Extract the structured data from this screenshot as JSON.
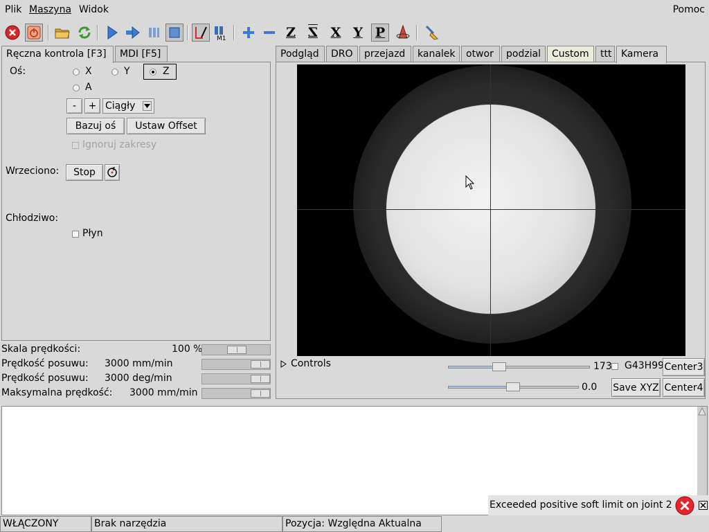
{
  "menu": {
    "file": "Plik",
    "machine": "Maszyna",
    "view": "Widok",
    "help": "Pomoc"
  },
  "toolbar": {
    "icons": [
      "estop-icon",
      "power-icon",
      "open-file-icon",
      "reload-icon",
      "run-icon",
      "step-icon",
      "pause-icon",
      "stop-icon",
      "block-delete-icon",
      "optional-stop-icon",
      "zoom-in-icon",
      "zoom-out-icon",
      "view-z-icon",
      "view-z-rotated-icon",
      "view-x-icon",
      "view-y-icon",
      "view-p-icon",
      "rotate-view-icon",
      "clear-backplot-icon"
    ],
    "m1_label": "M1",
    "view_letters": {
      "z": "Z",
      "z2": "Z",
      "x": "X",
      "y": "Y",
      "p": "P"
    }
  },
  "left_tabs": [
    "Ręczna kontrola [F3]",
    "MDI [F5]"
  ],
  "manual": {
    "axis_label": "Oś:",
    "axes": {
      "x": "X",
      "y": "Y",
      "z": "Z",
      "a": "A"
    },
    "selected_axis": "Z",
    "minus": "-",
    "plus": "+",
    "jog_mode": "Ciągły",
    "home_button": "Bazuj oś",
    "offset_button": "Ustaw Offset",
    "ignore_limits": "Ignoruj zakresy",
    "spindle_label": "Wrzeciono:",
    "spindle_stop": "Stop",
    "coolant_label": "Chłodziwo:",
    "flood": "Płyn"
  },
  "overrides": [
    {
      "label": "Skala prędkości:",
      "value": "100 %",
      "level": 0.5
    },
    {
      "label": "Prędkość posuwu:",
      "value": "3000 mm/min",
      "level": 1.0
    },
    {
      "label": "Prędkość posuwu:",
      "value": "3000 deg/min",
      "level": 1.0
    },
    {
      "label": "Maksymalna prędkość:",
      "value": "3000 mm/min",
      "level": 1.0
    }
  ],
  "right_tabs": [
    "Podgląd",
    "DRO",
    "przejazd",
    "kanalek",
    "otwor",
    "podzial",
    "Custom",
    "ttt",
    "Kamera"
  ],
  "active_right_tab": "Kamera",
  "camera": {
    "controls_label": "Controls",
    "slider1_value": "173",
    "slider2_value": "0.0",
    "g43_label": "G43H99",
    "center3": "Center3",
    "center4": "Center4",
    "save_xyz": "Save XYZ"
  },
  "notification": {
    "text": "Exceeded positive soft limit on joint 2"
  },
  "status": {
    "machine": "WŁĄCZONY",
    "tool": "Brak narzędzia",
    "position": "Pozycja: Względna Aktualna"
  }
}
